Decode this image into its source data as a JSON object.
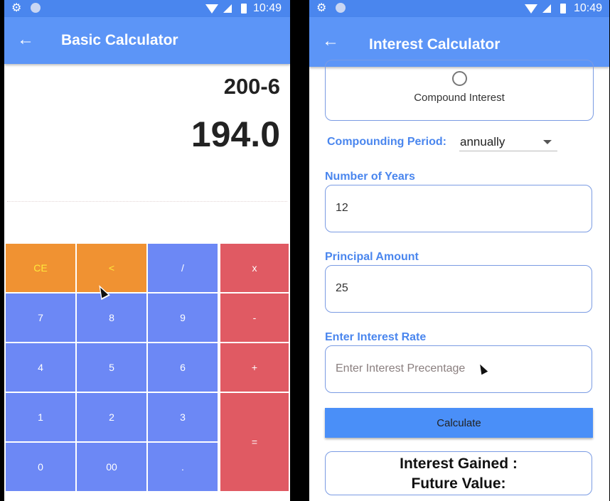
{
  "status_bar": {
    "time": "10:49"
  },
  "basic_calculator": {
    "title": "Basic Calculator",
    "expression": "200-6",
    "result": "194.0",
    "keys": {
      "ce": "CE",
      "back": "<",
      "divide": "/",
      "multiply": "x",
      "seven": "7",
      "eight": "8",
      "nine": "9",
      "minus": "-",
      "four": "4",
      "five": "5",
      "six": "6",
      "plus": "+",
      "one": "1",
      "two": "2",
      "three": "3",
      "equals": "=",
      "zero": "0",
      "double_zero": "00",
      "dot": "."
    }
  },
  "interest_calculator": {
    "title": "Interest Calculator",
    "radio_option": "Compound Interest",
    "compounding_label": "Compounding Period:",
    "compounding_value": "annually",
    "years_label": "Number of Years",
    "years_value": "12",
    "principal_label": "Principal Amount",
    "principal_value": "25",
    "rate_label": "Enter Interest Rate",
    "rate_placeholder": "Enter Interest Precentage",
    "calculate_button": "Calculate",
    "interest_gained_label": "Interest Gained :",
    "future_value_label": "Future Value:"
  },
  "colors": {
    "app_bar": "#5c95f7",
    "status_bar": "#4a86ee",
    "key_blue": "#6c88f5",
    "key_orange": "#f09232",
    "key_red": "#e05a63",
    "accent_label": "#4a86ee"
  },
  "icons": [
    "gear-icon",
    "notification-dot-icon",
    "wifi-icon",
    "signal-icon",
    "battery-icon",
    "back-arrow-icon",
    "radio-button-icon",
    "dropdown-caret-icon",
    "mouse-cursor-icon"
  ]
}
